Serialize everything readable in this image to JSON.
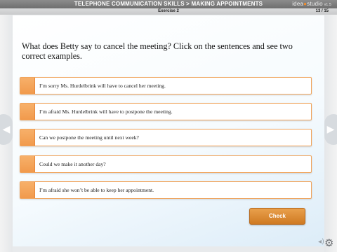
{
  "header": {
    "title": "TELEPHONE COMMUNICATION SKILLS > MAKING APPOINTMENTS",
    "brand_a": "idea",
    "brand_b": "studio",
    "brand_version": "v1.5",
    "exercise": "Exercise 2",
    "page": "13 / 15"
  },
  "question": "What does Betty say to cancel the meeting? Click on the sentences and see two correct examples.",
  "options": [
    {
      "text": "I’m sorry Ms. Hurdelbrink will have to cancel her meeting."
    },
    {
      "text": "I’m afraid Ms. Hurdelbrink will have to postpone the meeting."
    },
    {
      "text": "Can we postpone the meeting until next week?"
    },
    {
      "text": "Could we make it another day?"
    },
    {
      "text": "I’m afraid she won’t be able to keep her appointment."
    }
  ],
  "check_label": "Check",
  "icons": {
    "prev": "chevron-left-icon",
    "next": "chevron-right-icon",
    "audio": "speaker-icon",
    "settings": "gear-icon"
  },
  "colors": {
    "accent": "#f19a4c",
    "button": "#d9852c",
    "topbar": "#7a7a7a"
  }
}
